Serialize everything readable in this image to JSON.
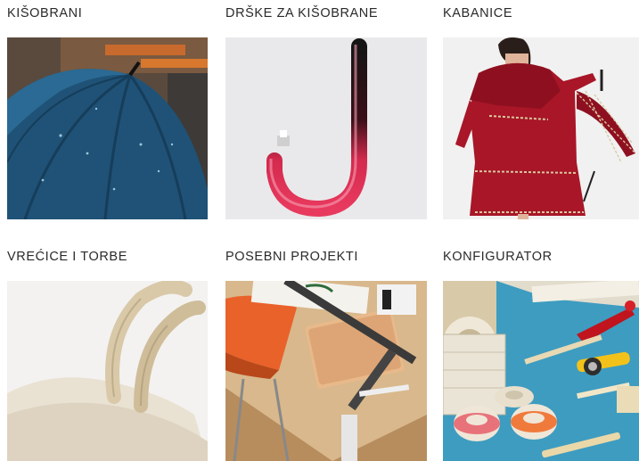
{
  "categories": [
    {
      "title": "KIŠOBRANI",
      "image": "umbrella-photo"
    },
    {
      "title": "DRŠKE ZA KIŠOBRANE",
      "image": "umbrella-handle-photo"
    },
    {
      "title": "KABANICE",
      "image": "raincoat-photo"
    },
    {
      "title": "VREĆICE I TORBE",
      "image": "tote-bag-photo"
    },
    {
      "title": "POSEBNI PROJEKTI",
      "image": "workbench-photo"
    },
    {
      "title": "KONFIGURATOR",
      "image": "craft-tools-photo"
    }
  ]
}
